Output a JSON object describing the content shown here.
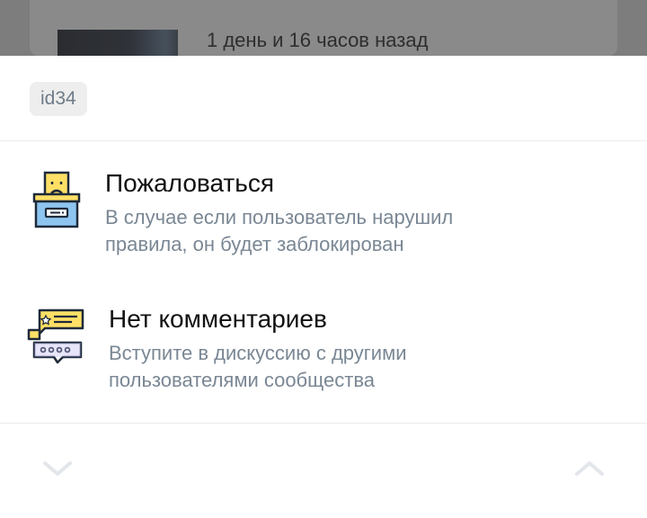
{
  "background": {
    "time_ago": "1 день и 16 часов назад"
  },
  "sheet": {
    "user_id": "id34",
    "items": [
      {
        "icon": "complaint-box-icon",
        "title": "Пожаловаться",
        "desc_line1": "В случае если пользователь нарушил",
        "desc_line2": "правила, он будет заблокирован"
      },
      {
        "icon": "chat-bubbles-icon",
        "title": "Нет комментариев",
        "desc_line1": "Вступите в дискуссию с другими",
        "desc_line2": "пользователями сообщества"
      }
    ],
    "nav": {
      "prev_icon": "chevron-down-icon",
      "next_icon": "chevron-up-icon"
    }
  },
  "colors": {
    "accent_yellow": "#FFE066",
    "accent_blue": "#8EC5F0",
    "outline": "#1E2A3A",
    "muted_text": "#7A8794"
  }
}
